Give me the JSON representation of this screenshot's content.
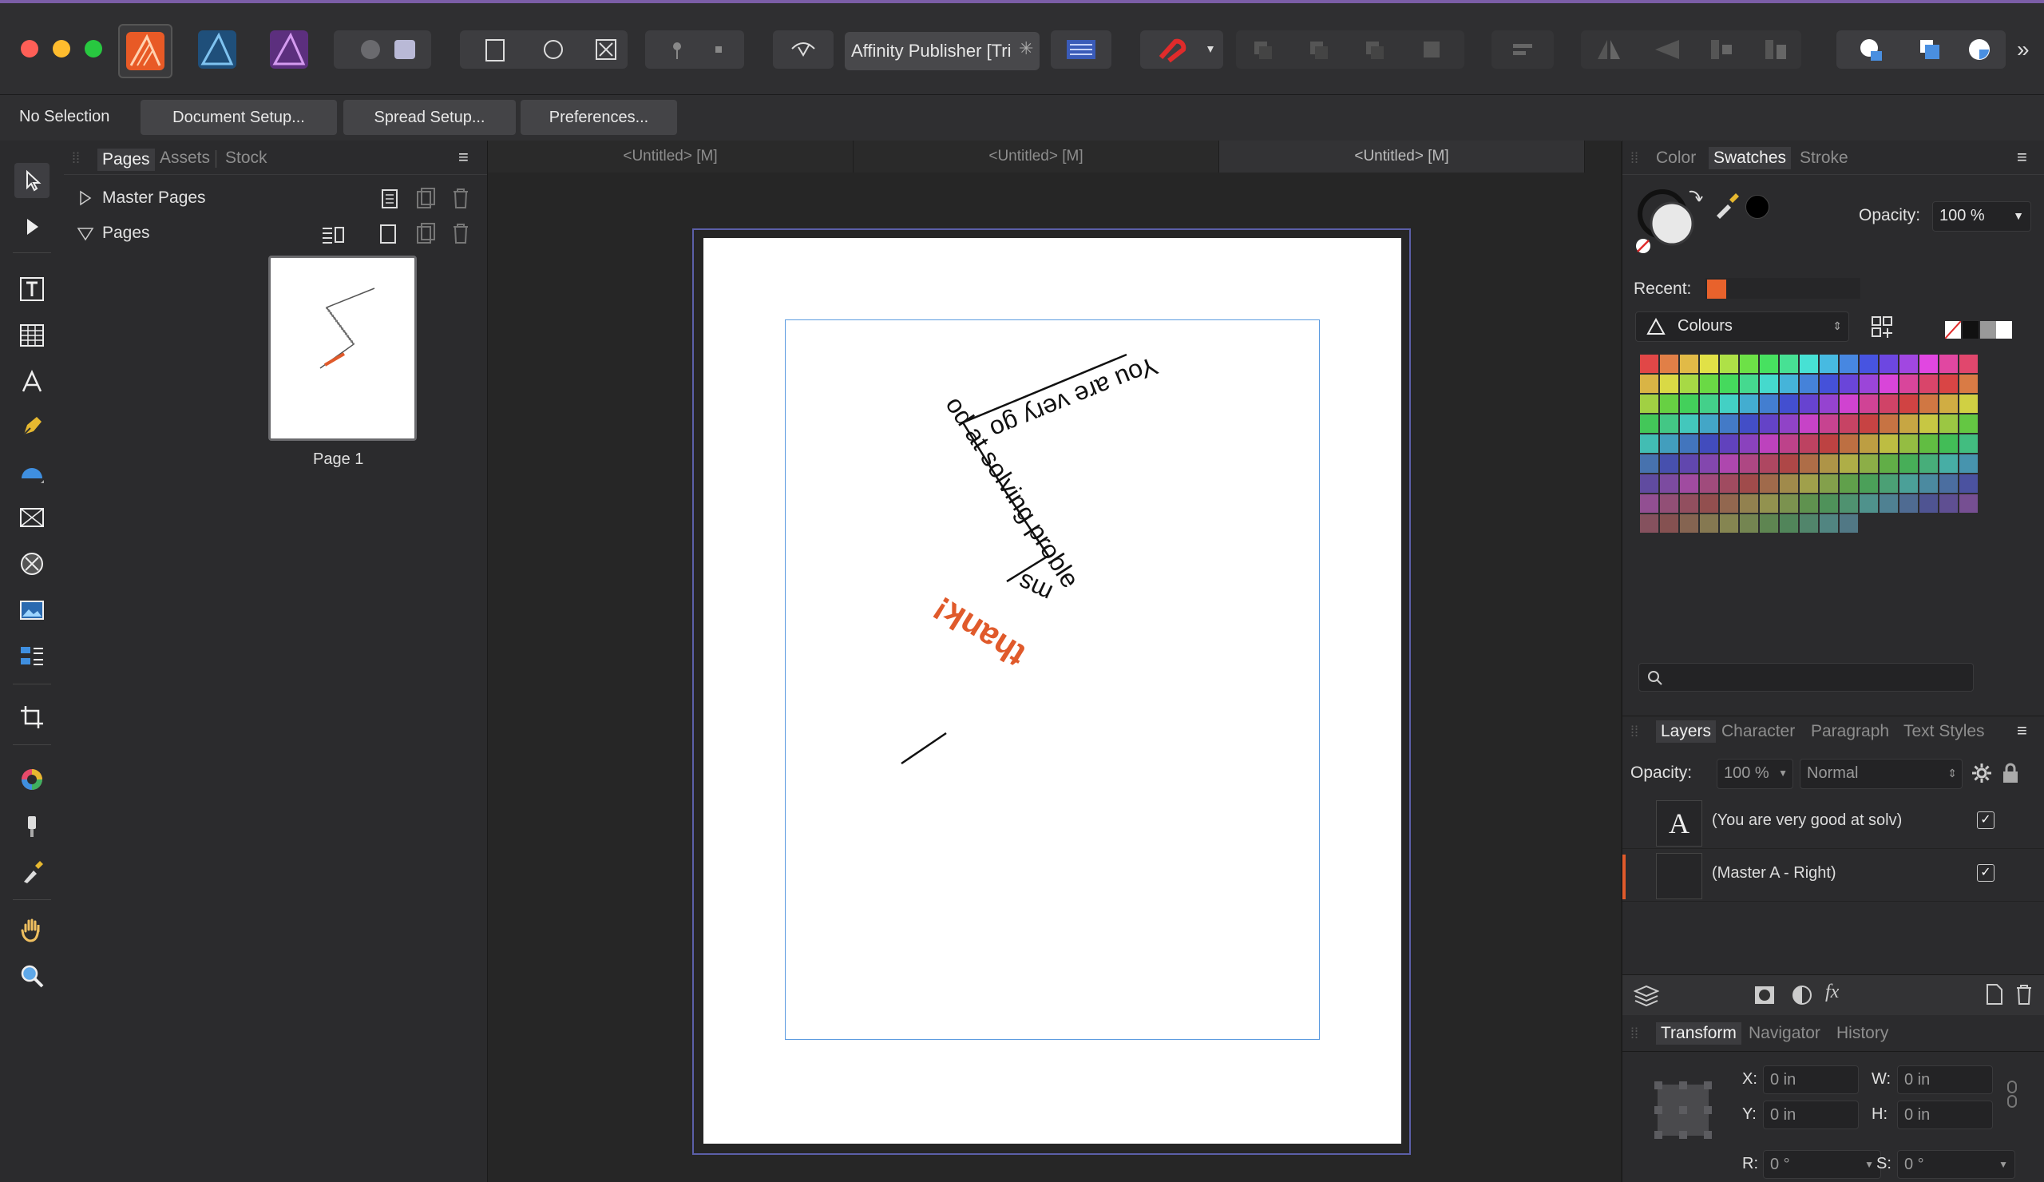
{
  "app": {
    "title_button": "Affinity Publisher [Tri",
    "traffic_colors": [
      "#ff5f57",
      "#febc2e",
      "#28c840"
    ]
  },
  "context_bar": {
    "selection_label": "No Selection",
    "buttons": [
      "Document Setup...",
      "Spread Setup...",
      "Preferences..."
    ]
  },
  "left_panel": {
    "tabs": [
      "Pages",
      "Assets",
      "Stock"
    ],
    "active_tab": "Pages",
    "master_pages_label": "Master Pages",
    "pages_label": "Pages",
    "page_thumb_label": "Page 1"
  },
  "document": {
    "tabs": [
      "<Untitled> [M]",
      "<Untitled> [M]",
      "<Untitled> [M]"
    ],
    "active_tab_index": 2,
    "path_text_black": "You are very good at solving problems",
    "path_text_orange": "thanks",
    "path_text_black_1": "You are very go",
    "path_text_black_2": "od at solving proble",
    "path_text_black_3": "ms",
    "path_text_orange_visible": "thank!",
    "accent_color": "#e05a2b"
  },
  "right_panel": {
    "top_tabs": [
      "Color",
      "Swatches",
      "Stroke"
    ],
    "active_top_tab": "Swatches",
    "opacity_label": "Opacity:",
    "opacity_value": "100 %",
    "recent_label": "Recent:",
    "recent_color": "#e8622c",
    "palette_name": "Colours",
    "layer_tabs": [
      "Layers",
      "Character",
      "Paragraph",
      "Text Styles"
    ],
    "active_layer_tab": "Layers",
    "layers_opacity_label": "Opacity:",
    "layers_opacity_value": "100 %",
    "blend_mode": "Normal",
    "layers": [
      {
        "name": "(You are very good at solv)",
        "thumb": "A",
        "visible": true
      },
      {
        "name": "(Master A - Right)",
        "thumb": "",
        "visible": true
      }
    ],
    "bottom_tabs": [
      "Transform",
      "Navigator",
      "History"
    ],
    "active_bottom_tab": "Transform",
    "transform": {
      "x_label": "X:",
      "x_value": "0 in",
      "y_label": "Y:",
      "y_value": "0 in",
      "w_label": "W:",
      "w_value": "0 in",
      "h_label": "H:",
      "h_value": "0 in",
      "r_label": "R:",
      "r_value": "0 °",
      "s_label": "S:",
      "s_value": "0 °"
    }
  }
}
